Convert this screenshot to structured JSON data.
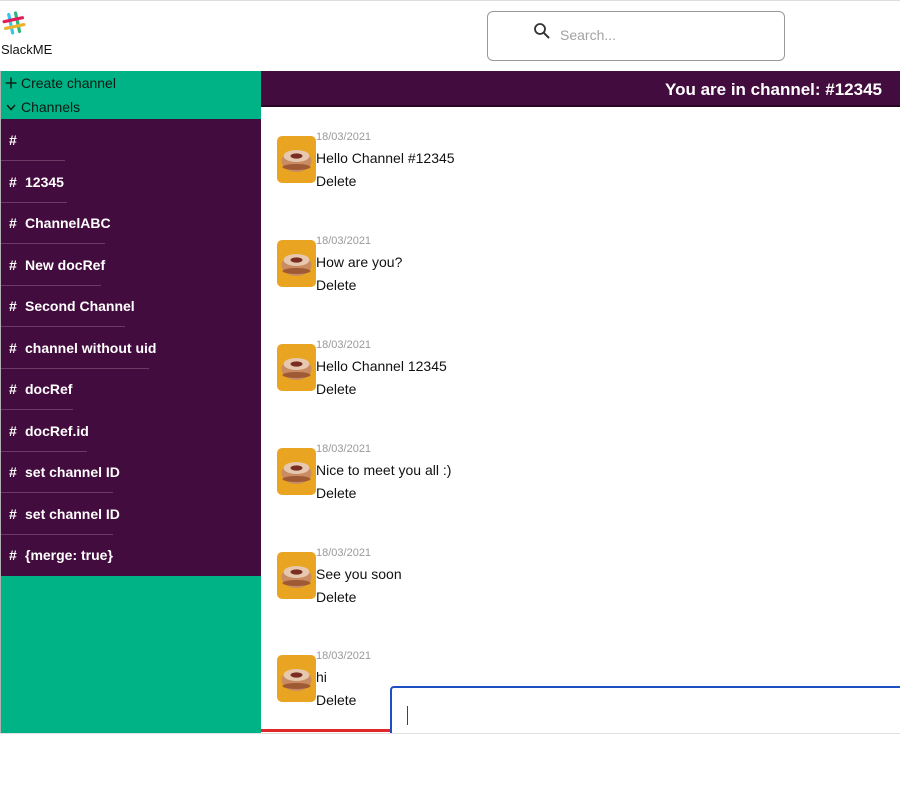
{
  "app": {
    "brand": "SlackME"
  },
  "search": {
    "placeholder": "Search..."
  },
  "sidebar": {
    "create_label": "Create channel",
    "channels_label": "Channels",
    "channels": [
      {
        "hash": "#",
        "name": ""
      },
      {
        "hash": "#",
        "name": "12345"
      },
      {
        "hash": "#",
        "name": "ChannelABC"
      },
      {
        "hash": "#",
        "name": "New docRef"
      },
      {
        "hash": "#",
        "name": "Second Channel"
      },
      {
        "hash": "#",
        "name": "channel without uid"
      },
      {
        "hash": "#",
        "name": "docRef"
      },
      {
        "hash": "#",
        "name": "docRef.id"
      },
      {
        "hash": "#",
        "name": "set channel ID"
      },
      {
        "hash": "#",
        "name": "set channel ID"
      },
      {
        "hash": "#",
        "name": "{merge: true}"
      }
    ]
  },
  "channel_header": {
    "title": "You are in channel: #12345"
  },
  "messages": [
    {
      "date": "18/03/2021",
      "text": "Hello Channel #12345",
      "delete_label": "Delete"
    },
    {
      "date": "18/03/2021",
      "text": "How are you?",
      "delete_label": "Delete"
    },
    {
      "date": "18/03/2021",
      "text": "Hello Channel 12345",
      "delete_label": "Delete"
    },
    {
      "date": "18/03/2021",
      "text": "Nice to meet you all :)",
      "delete_label": "Delete"
    },
    {
      "date": "18/03/2021",
      "text": "See you soon",
      "delete_label": "Delete"
    },
    {
      "date": "18/03/2021",
      "text": "hi",
      "delete_label": "Delete"
    }
  ],
  "composer": {
    "value": ""
  },
  "colors": {
    "sidebar_green": "#00b386",
    "aubergine": "#430c3e",
    "composer_border": "#1d4fc4",
    "accent_red": "#e12727"
  },
  "icons": [
    "slack-logo-icon",
    "search-icon",
    "plus-icon",
    "chevron-down-icon",
    "avatar-donut-icon"
  ]
}
